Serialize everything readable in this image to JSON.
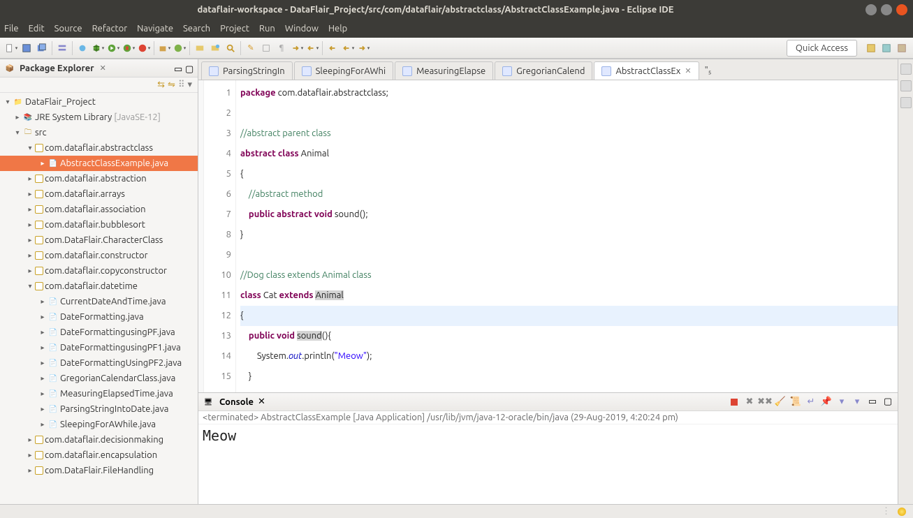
{
  "window": {
    "title": "dataflair-workspace - DataFlair_Project/src/com/dataflair/abstractclass/AbstractClassExample.java - Eclipse IDE"
  },
  "menu": [
    "File",
    "Edit",
    "Source",
    "Refactor",
    "Navigate",
    "Search",
    "Project",
    "Run",
    "Window",
    "Help"
  ],
  "quick_access": "Quick Access",
  "package_explorer": {
    "title": "Package Explorer"
  },
  "tree": {
    "project": "DataFlair_Project",
    "jre": "JRE System Library",
    "jre_suffix": "[JavaSE-12]",
    "src": "src",
    "packages": [
      "com.dataflair.abstractclass",
      "com.dataflair.abstraction",
      "com.dataflair.arrays",
      "com.dataflair.association",
      "com.dataflair.bubblesort",
      "com.DataFlair.CharacterClass",
      "com.dataflair.constructor",
      "com.dataflair.copyconstructor",
      "com.dataflair.datetime",
      "com.dataflair.decisionmaking",
      "com.dataflair.encapsulation",
      "com.DataFlair.FileHandling"
    ],
    "selected_file": "AbstractClassExample.java",
    "datetime_files": [
      "CurrentDateAndTime.java",
      "DateFormatting.java",
      "DateFormattingusingPF.java",
      "DateFormattingusingPF1.java",
      "DateFormattingUsingPF2.java",
      "GregorianCalendarClass.java",
      "MeasuringElapsedTime.java",
      "ParsingStringIntoDate.java",
      "SleepingForAWhile.java"
    ]
  },
  "editor_tabs": [
    "ParsingStringIn",
    "SleepingForAWhi",
    "MeasuringElapse",
    "GregorianCalend",
    "AbstractClassEx"
  ],
  "overflow_label": "\"₅",
  "code_lines": {
    "l1a": "package",
    "l1b": " com.dataflair.abstractclass;",
    "l3": "//abstract parent class",
    "l4a": "abstract",
    "l4b": "class",
    "l4c": " Animal",
    "l5": "{",
    "l6sp": "    ",
    "l6": "//abstract method",
    "l7sp": "    ",
    "l7a": "public",
    "l7b": "abstract",
    "l7c": "void",
    "l7d": " sound();",
    "l8": "}",
    "l10": "//Dog class extends Animal class",
    "l11a": "class",
    "l11b": " Cat ",
    "l11c": "extends",
    "l11d": "Animal",
    "l12": "{",
    "l13sp": "    ",
    "l13a": "public",
    "l13b": "void",
    "l13c": "sound",
    "l13d": "(){",
    "l14sp": "        ",
    "l14a": "System.",
    "l14b": "out",
    "l14c": ".println(",
    "l14d": "\"Meow\"",
    "l14e": ");",
    "l15sp": "    ",
    "l15": "}"
  },
  "line_numbers": [
    "1",
    "2",
    "3",
    "4",
    "5",
    "6",
    "7",
    "8",
    "9",
    "10",
    "11",
    "12",
    "13",
    "14",
    "15"
  ],
  "console": {
    "title": "Console",
    "status": "<terminated> AbstractClassExample [Java Application] /usr/lib/jvm/java-12-oracle/bin/java (29-Aug-2019, 4:20:24 pm)",
    "output": "Meow"
  }
}
